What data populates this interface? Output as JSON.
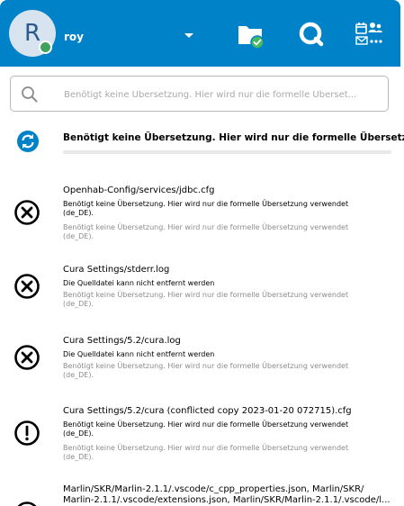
{
  "header": {
    "avatar_initial": "R",
    "username": "roy",
    "icons": [
      "folder-check-icon",
      "talk-search-icon",
      "calendar-contacts-mail-icon"
    ]
  },
  "search": {
    "placeholder": "Benötigt keine Übersetzung. Hier wird nur die formelle Überset..."
  },
  "sync": {
    "text": "Benötigt keine Übersetzung. Hier wird nur die formelle Übersetzun"
  },
  "activities": [
    {
      "icon": "error-x-icon",
      "title": "Openhab-Config/services/jdbc.cfg",
      "message": "Benötigt keine Übersetzung. Hier wird nur die formelle Übersetzung verwendet (de_DE).",
      "detail": "Benötigt keine Übersetzung. Hier wird nur die formelle Übersetzung verwendet (de_DE)."
    },
    {
      "icon": "error-x-icon",
      "title": "Cura Settings/stderr.log",
      "message": "Die Quelldatei kann nicht entfernt werden",
      "detail": "Benötigt keine Übersetzung. Hier wird nur die formelle Übersetzung verwendet (de_DE)."
    },
    {
      "icon": "error-x-icon",
      "title": "Cura Settings/5.2/cura.log",
      "message": "Die Quelldatei kann nicht entfernt werden",
      "detail": "Benötigt keine Übersetzung. Hier wird nur die formelle Übersetzung verwendet (de_DE)."
    },
    {
      "icon": "warning-exclamation-icon",
      "title": "Cura Settings/5.2/cura (conflicted copy 2023-01-20 072715).cfg",
      "message": "Benötigt keine Übersetzung. Hier wird nur die formelle Übersetzung verwendet (de_DE).",
      "detail": "Benötigt keine Übersetzung. Hier wird nur die formelle Übersetzung verwendet (de_DE)."
    },
    {
      "icon": "error-x-icon",
      "title": "Marlin/SKR/Marlin-2.1.1/.vscode/c_cpp_properties.json, Marlin/SKR/ Marlin-2.1.1/.vscode/extensions.json, Marlin/SKR/Marlin-2.1.1/.vscode/l..."
    }
  ],
  "colors": {
    "header_bg": "#0082c9",
    "accent": "#0082c9",
    "status_online": "#3fa35e",
    "folder_check": "#46ba61"
  }
}
